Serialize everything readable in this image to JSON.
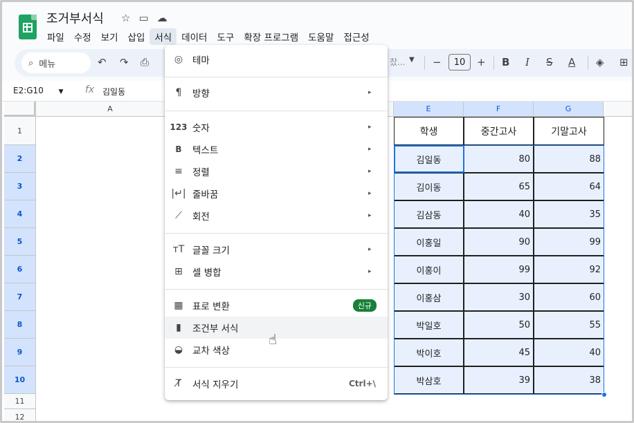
{
  "doc": {
    "title": "조거부서식"
  },
  "menubar": [
    "파일",
    "수정",
    "보기",
    "삽입",
    "서식",
    "데이터",
    "도구",
    "확장 프로그램",
    "도움말",
    "접근성"
  ],
  "toolbar": {
    "search_label": "메뉴",
    "font_size": "10",
    "font_name_fragment": "찼..."
  },
  "formula": {
    "namebox": "E2:G10",
    "fx": "fx",
    "value": "김일동"
  },
  "columns": [
    "A",
    "E",
    "F",
    "G"
  ],
  "rows": [
    "1",
    "2",
    "3",
    "4",
    "5",
    "6",
    "7",
    "8",
    "9",
    "10",
    "11",
    "12"
  ],
  "table": {
    "headers": [
      "학생",
      "중간고사",
      "기말고사"
    ],
    "rows": [
      [
        "김일동",
        "80",
        "88"
      ],
      [
        "김이동",
        "65",
        "64"
      ],
      [
        "김삼동",
        "40",
        "35"
      ],
      [
        "이홍일",
        "90",
        "99"
      ],
      [
        "이홍이",
        "99",
        "92"
      ],
      [
        "이홍삼",
        "30",
        "60"
      ],
      [
        "박일호",
        "50",
        "55"
      ],
      [
        "박이호",
        "45",
        "40"
      ],
      [
        "박삼호",
        "39",
        "38"
      ]
    ]
  },
  "format_menu": {
    "items": [
      {
        "icon": "palette-icon",
        "glyph": "◎",
        "label": "테마"
      },
      {
        "icon": "text-direction-icon",
        "glyph": "¶",
        "label": "방향",
        "submenu": "▸"
      },
      {
        "icon": "number-icon",
        "glyph": "123",
        "label": "숫자",
        "submenu": "▸"
      },
      {
        "icon": "bold-icon",
        "glyph": "B",
        "label": "텍스트",
        "submenu": "▸"
      },
      {
        "icon": "align-icon",
        "glyph": "≡",
        "label": "정렬",
        "submenu": "▸"
      },
      {
        "icon": "wrap-icon",
        "glyph": "|↵|",
        "label": "줄바꿈",
        "submenu": "▸"
      },
      {
        "icon": "rotate-icon",
        "glyph": "⟋",
        "label": "회전",
        "submenu": "▸"
      },
      {
        "icon": "font-size-icon",
        "glyph": "тT",
        "label": "글꼴 크기",
        "submenu": "▸"
      },
      {
        "icon": "merge-icon",
        "glyph": "⊞",
        "label": "셀 병합",
        "submenu": "▸"
      },
      {
        "icon": "table-icon",
        "glyph": "▦",
        "label": "표로 변환",
        "badge": "신규"
      },
      {
        "icon": "paint-roller-icon",
        "glyph": "▮",
        "label": "조건부 서식"
      },
      {
        "icon": "color-drop-icon",
        "glyph": "◒",
        "label": "교차 색상"
      },
      {
        "icon": "clear-format-icon",
        "glyph": "T̸",
        "label": "서식 지우기",
        "shortcut": "Ctrl+\\"
      }
    ]
  },
  "colors": {
    "accent": "#1a73e8",
    "selection": "#e8f0fe",
    "badge": "#188038",
    "logo": "#1ea362"
  }
}
